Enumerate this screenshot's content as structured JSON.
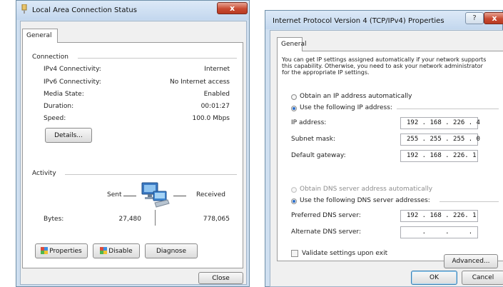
{
  "status_window": {
    "title": "Local Area Connection Status",
    "tab": "General",
    "connection": {
      "group_label": "Connection",
      "rows": [
        {
          "label": "IPv4 Connectivity:",
          "value": "Internet"
        },
        {
          "label": "IPv6 Connectivity:",
          "value": "No Internet access"
        },
        {
          "label": "Media State:",
          "value": "Enabled"
        },
        {
          "label": "Duration:",
          "value": "00:01:27"
        },
        {
          "label": "Speed:",
          "value": "100.0 Mbps"
        }
      ],
      "details_button": "Details..."
    },
    "activity": {
      "group_label": "Activity",
      "sent_label": "Sent",
      "received_label": "Received",
      "bytes_label": "Bytes:",
      "bytes_sent": "27,480",
      "bytes_received": "778,065"
    },
    "buttons": {
      "properties": "Properties",
      "disable": "Disable",
      "diagnose": "Diagnose",
      "close": "Close"
    },
    "close_glyph": "x"
  },
  "ipv4_window": {
    "title": "Internet Protocol Version 4 (TCP/IPv4) Properties",
    "tab": "General",
    "help_glyph": "?",
    "description": [
      "You can get IP settings assigned automatically if your network supports",
      "this capability. Otherwise, you need to ask your network administrator",
      "for the appropriate IP settings."
    ],
    "ip": {
      "auto_label": "Obtain an IP address automatically",
      "manual_label": "Use the following IP address:",
      "address_label": "IP address:",
      "address_value": "192 . 168 . 226 . 4",
      "mask_label": "Subnet mask:",
      "mask_value": "255 . 255 . 255 . 0",
      "gateway_label": "Default gateway:",
      "gateway_value": "192 . 168 . 226. 1"
    },
    "dns": {
      "auto_label": "Obtain DNS server address automatically",
      "manual_label": "Use the following DNS server addresses:",
      "preferred_label": "Preferred DNS server:",
      "preferred_value": "192 . 168 . 226. 1",
      "alternate_label": "Alternate DNS server:",
      "alternate_value": "    .     .     ."
    },
    "validate_label": "Validate settings upon exit",
    "buttons": {
      "advanced": "Advanced...",
      "ok": "OK",
      "cancel": "Cancel"
    }
  }
}
